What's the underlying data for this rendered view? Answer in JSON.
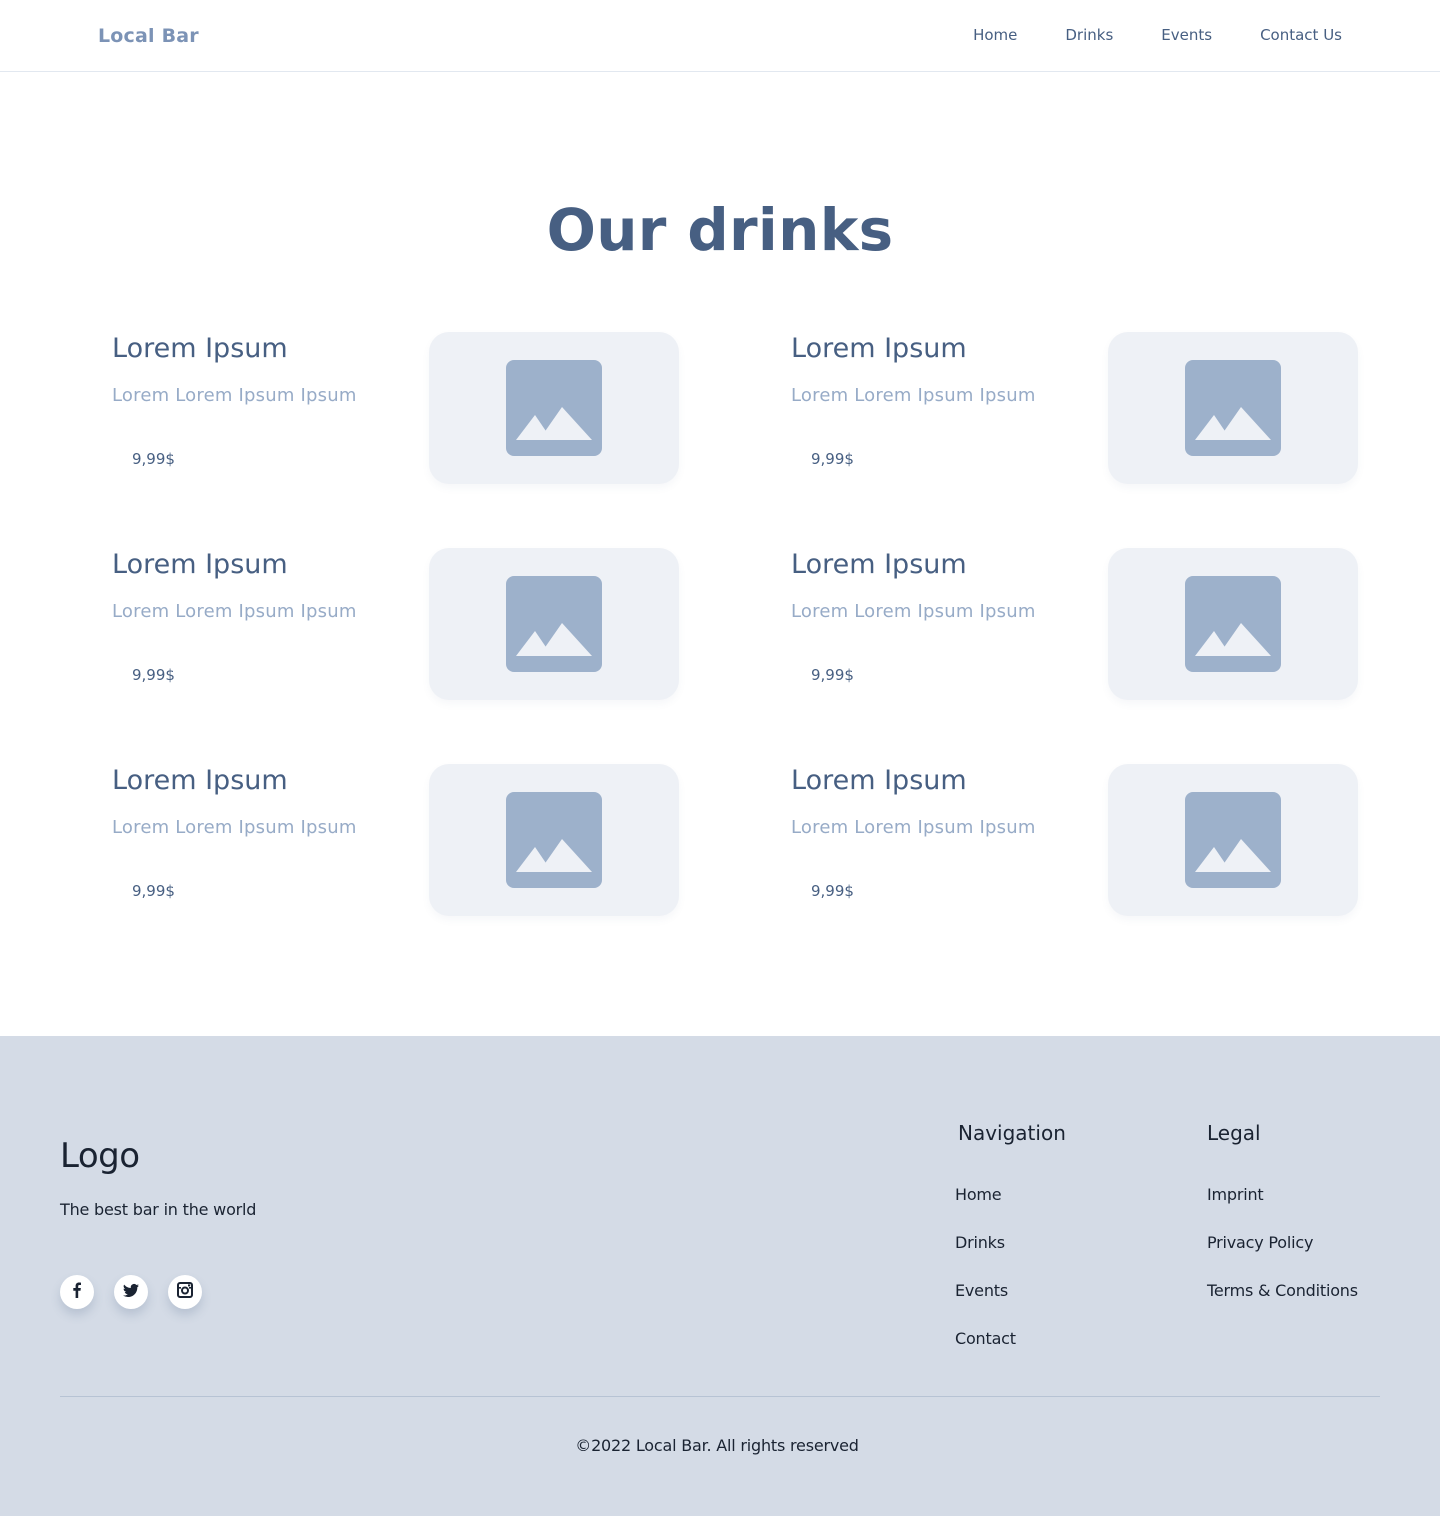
{
  "header": {
    "brand": "Local Bar",
    "nav": [
      "Home",
      "Drinks",
      "Events",
      "Contact Us"
    ]
  },
  "page_title": "Our drinks",
  "drinks": [
    {
      "name": "Lorem Ipsum",
      "description": "Lorem Lorem Ipsum Ipsum",
      "price": "9,99$",
      "image_icon": "image-placeholder-icon"
    },
    {
      "name": "Lorem Ipsum",
      "description": "Lorem Lorem Ipsum Ipsum",
      "price": "9,99$",
      "image_icon": "image-placeholder-icon"
    },
    {
      "name": "Lorem Ipsum",
      "description": "Lorem Lorem Ipsum Ipsum",
      "price": "9,99$",
      "image_icon": "image-placeholder-icon"
    },
    {
      "name": "Lorem Ipsum",
      "description": "Lorem Lorem Ipsum Ipsum",
      "price": "9,99$",
      "image_icon": "image-placeholder-icon"
    },
    {
      "name": "Lorem Ipsum",
      "description": "Lorem Lorem Ipsum Ipsum",
      "price": "9,99$",
      "image_icon": "image-placeholder-icon"
    },
    {
      "name": "Lorem Ipsum",
      "description": "Lorem Lorem Ipsum Ipsum",
      "price": "9,99$",
      "image_icon": "image-placeholder-icon"
    }
  ],
  "footer": {
    "logo": "Logo",
    "tagline": "The best bar in the world",
    "socials": [
      "facebook-icon",
      "twitter-icon",
      "instagram-icon"
    ],
    "navigation": {
      "title": "Navigation",
      "links": [
        "Home",
        "Drinks",
        "Events",
        "Contact"
      ]
    },
    "legal": {
      "title": "Legal",
      "links": [
        "Imprint",
        "Privacy Policy",
        "Terms & Conditions"
      ]
    },
    "copyright": "©2022 Local Bar. All rights reserved"
  },
  "colors": {
    "primary_text": "#475F82",
    "muted_text": "#97ABC7",
    "brand": "#7C93B6",
    "card_bg": "#EEF1F6",
    "placeholder_icon": "#9DB1CB",
    "footer_bg": "#D4DBE6",
    "footer_text": "#1A2332"
  }
}
